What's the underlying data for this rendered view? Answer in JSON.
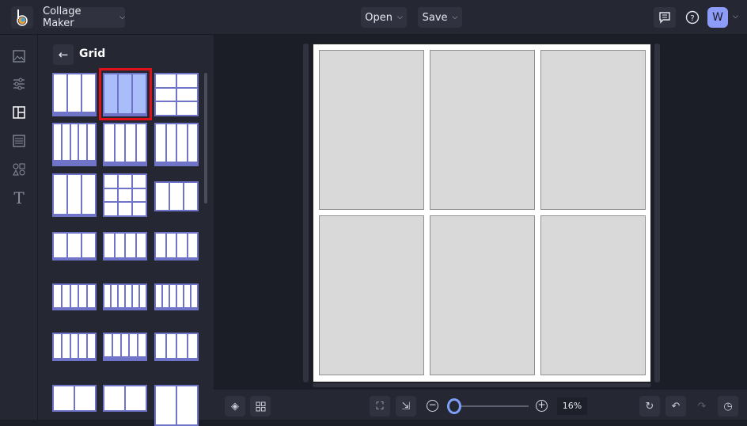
{
  "header": {
    "app_title": "Collage Maker",
    "open_label": "Open",
    "save_label": "Save",
    "avatar_initial": "W"
  },
  "panel": {
    "title": "Grid"
  },
  "zoom": {
    "percent_label": "16%",
    "level": 0.16
  },
  "colors": {
    "accent": "#6f74c9",
    "selected_fill": "#a9bdfb",
    "selection_outline": "#e0101a",
    "avatar": "#8c9cf8"
  }
}
